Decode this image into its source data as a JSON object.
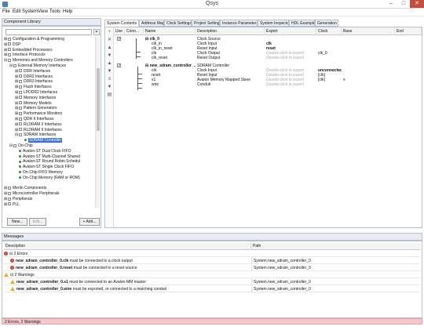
{
  "window": {
    "title": "Qsys",
    "minimize": "–",
    "maximize": "□",
    "close": "✕"
  },
  "menu": [
    "File",
    "Edit",
    "System",
    "View",
    "Tools",
    "Help"
  ],
  "library": {
    "title": "Component Library",
    "search_placeholder": "",
    "clear": "✕",
    "tree": [
      {
        "label": "Configuration & Programming",
        "indent": 0,
        "exp": "⊞",
        "kind": "folder"
      },
      {
        "label": "DSP",
        "indent": 0,
        "exp": "⊞",
        "kind": "folder"
      },
      {
        "label": "Embedded Processors",
        "indent": 0,
        "exp": "⊞",
        "kind": "folder"
      },
      {
        "label": "Interface Protocols",
        "indent": 0,
        "exp": "⊞",
        "kind": "folder"
      },
      {
        "label": "Memories and Memory Controllers",
        "indent": 0,
        "exp": "⊟",
        "kind": "folder"
      },
      {
        "label": "External Memory Interfaces",
        "indent": 1,
        "exp": "⊟",
        "kind": "folder"
      },
      {
        "label": "DDR Interfaces",
        "indent": 2,
        "exp": "⊞",
        "kind": "folder"
      },
      {
        "label": "DDR2 Interfaces",
        "indent": 2,
        "exp": "⊞",
        "kind": "folder"
      },
      {
        "label": "DDR3 Interfaces",
        "indent": 2,
        "exp": "⊞",
        "kind": "folder"
      },
      {
        "label": "Flash Interfaces",
        "indent": 2,
        "exp": "⊞",
        "kind": "folder"
      },
      {
        "label": "LPDDR2 Interfaces",
        "indent": 2,
        "exp": "⊞",
        "kind": "folder"
      },
      {
        "label": "Memory Interfaces",
        "indent": 2,
        "exp": "⊞",
        "kind": "folder"
      },
      {
        "label": "Memory Models",
        "indent": 2,
        "exp": "⊞",
        "kind": "folder"
      },
      {
        "label": "Pattern Generators",
        "indent": 2,
        "exp": "⊞",
        "kind": "folder"
      },
      {
        "label": "Performance Monitors",
        "indent": 2,
        "exp": "⊞",
        "kind": "folder"
      },
      {
        "label": "QDR II Interfaces",
        "indent": 2,
        "exp": "⊞",
        "kind": "folder"
      },
      {
        "label": "RLDRAM 2 Interfaces",
        "indent": 2,
        "exp": "⊞",
        "kind": "folder"
      },
      {
        "label": "RLDRAM II Interfaces",
        "indent": 2,
        "exp": "⊞",
        "kind": "folder"
      },
      {
        "label": "SDRAM Interfaces",
        "indent": 2,
        "exp": "⊟",
        "kind": "folder"
      },
      {
        "label": "SDRAM Controller",
        "indent": 3,
        "exp": "",
        "kind": "item",
        "selected": true
      },
      {
        "label": "On-Chip",
        "indent": 1,
        "exp": "⊟",
        "kind": "folder"
      },
      {
        "label": "Avalon-ST Dual Clock FIFO",
        "indent": 2,
        "exp": "",
        "kind": "item"
      },
      {
        "label": "Avalon-ST Multi-Channel Shared",
        "indent": 2,
        "exp": "",
        "kind": "item"
      },
      {
        "label": "Avalon-ST Round Robin Schedul",
        "indent": 2,
        "exp": "",
        "kind": "item"
      },
      {
        "label": "Avalon-ST Single Clock FIFO",
        "indent": 2,
        "exp": "",
        "kind": "item"
      },
      {
        "label": "On-Chip FIFO Memory",
        "indent": 2,
        "exp": "",
        "kind": "item"
      },
      {
        "label": "On-Chip Memory (RAM or ROM)",
        "indent": 2,
        "exp": "",
        "kind": "item"
      },
      {
        "label": "",
        "indent": 0,
        "exp": "",
        "kind": "spacer"
      },
      {
        "label": "Merlin Components",
        "indent": 0,
        "exp": "⊞",
        "kind": "folder"
      },
      {
        "label": "Microcontroller Peripherals",
        "indent": 0,
        "exp": "⊞",
        "kind": "folder"
      },
      {
        "label": "Peripherals",
        "indent": 0,
        "exp": "⊞",
        "kind": "folder"
      },
      {
        "label": "PLL",
        "indent": 0,
        "exp": "⊞",
        "kind": "folder"
      }
    ],
    "buttons": {
      "new": "New...",
      "edit": "Edit...",
      "add": "+ Add..."
    }
  },
  "tabs": [
    "System Contents",
    "Address Map",
    "Clock Settings",
    "Project Settings",
    "Instance Parameters",
    "System Inspector",
    "HDL Example",
    "Generation"
  ],
  "toolbar_icons": [
    "+",
    "✕",
    "▲",
    "▼",
    "▲",
    "▼",
    "≡",
    "▼",
    "▤"
  ],
  "grid": {
    "headers": [
      "Use",
      "Conn...",
      "Name",
      "Description",
      "Export",
      "Clock",
      "Base",
      "End"
    ],
    "rows": [
      {
        "use": "✓",
        "name": "⊟ clk_0",
        "name_class": "bold",
        "desc": "Clock Source",
        "export": "",
        "clock": "",
        "base": "",
        "end": "",
        "export_class": ""
      },
      {
        "use": "",
        "name": "clk_in",
        "desc": "Clock Input",
        "export": "clk",
        "export_class": "bold",
        "clock": "",
        "base": "",
        "end": ""
      },
      {
        "use": "",
        "name": "clk_in_reset",
        "desc": "Reset Input",
        "export": "reset",
        "export_class": "bold",
        "clock": "",
        "base": "",
        "end": ""
      },
      {
        "use": "",
        "name": "clk",
        "desc": "Clock Output",
        "export": "Double-click to export",
        "export_class": "ghost",
        "clock": "clk_0",
        "base": "",
        "end": ""
      },
      {
        "use": "",
        "name": "clk_reset",
        "desc": "Reset Output",
        "export": "Double-click to export",
        "export_class": "ghost",
        "clock": "",
        "base": "",
        "end": ""
      },
      {
        "use": "✓",
        "name": "⊟ new_sdram_controller_...",
        "name_class": "bold",
        "desc": "SDRAM Controller",
        "export": "",
        "export_class": "",
        "clock": "",
        "base": "",
        "end": ""
      },
      {
        "use": "",
        "name": "clk",
        "desc": "Clock Input",
        "export": "Double-click to export",
        "export_class": "ghost",
        "clock": "unconnected",
        "clock_class": "ital",
        "base": "",
        "end": ""
      },
      {
        "use": "",
        "name": "reset",
        "desc": "Reset Input",
        "export": "Double-click to export",
        "export_class": "ghost",
        "clock": "[clk]",
        "base": "",
        "end": ""
      },
      {
        "use": "",
        "name": "s1",
        "desc": "Avalon Memory Mapped Slave",
        "export": "Double-click to export",
        "export_class": "ghost",
        "clock": "[clk]",
        "base": "≡",
        "end": ""
      },
      {
        "use": "",
        "name": "wire",
        "desc": "Conduit",
        "export": "Double-click to export",
        "export_class": "ghost",
        "clock": "",
        "base": "",
        "end": ""
      }
    ]
  },
  "messages": {
    "title": "Messages",
    "headers": [
      "Description",
      "Path"
    ],
    "rows": [
      {
        "kind": "group-err",
        "text": "⊟ 2 Errors",
        "path": ""
      },
      {
        "kind": "err",
        "bold": "new_sdram_controller_0.clk",
        "text": " must be connected to a clock output",
        "path": "System.new_sdram_controller_0"
      },
      {
        "kind": "err",
        "bold": "new_sdram_controller_0.reset",
        "text": " must be connected to a reset source",
        "path": "System.new_sdram_controller_0"
      },
      {
        "kind": "group-warn",
        "text": "⊟ 2 Warnings",
        "path": ""
      },
      {
        "kind": "warn",
        "bold": "new_sdram_controller_0.s1",
        "text": " must be connected to an Avalon-MM master",
        "path": "System.new_sdram_controller_0"
      },
      {
        "kind": "warn",
        "bold": "new_sdram_controller_0.wire",
        "text": " must be exported, or connected to a matching conduit",
        "path": "System.new_sdram_controller_0"
      }
    ],
    "status": "2 Errors, 2 Warnings"
  }
}
